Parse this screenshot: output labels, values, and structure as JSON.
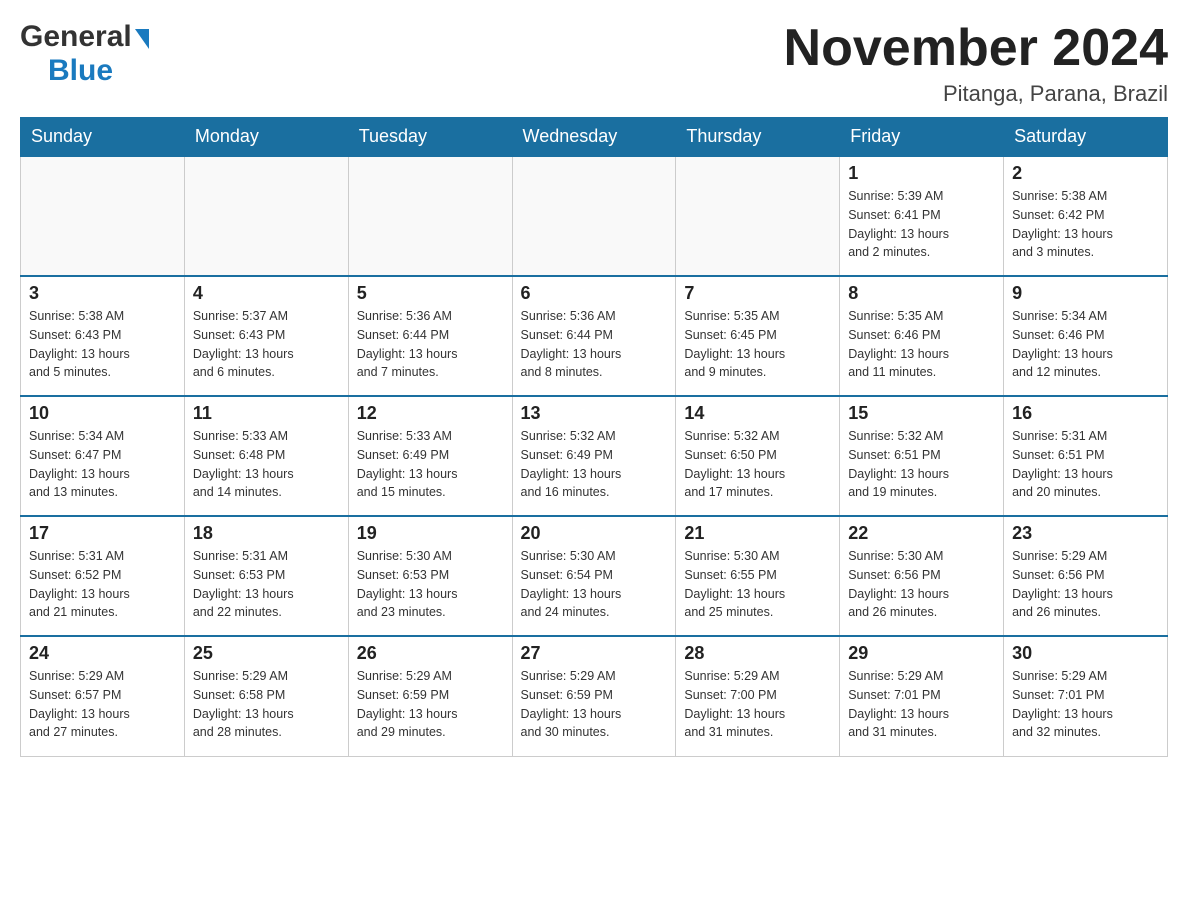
{
  "header": {
    "logo_general": "General",
    "logo_triangle": "▶",
    "logo_blue": "Blue",
    "month_title": "November 2024",
    "location": "Pitanga, Parana, Brazil"
  },
  "weekdays": [
    "Sunday",
    "Monday",
    "Tuesday",
    "Wednesday",
    "Thursday",
    "Friday",
    "Saturday"
  ],
  "weeks": [
    [
      {
        "day": "",
        "info": ""
      },
      {
        "day": "",
        "info": ""
      },
      {
        "day": "",
        "info": ""
      },
      {
        "day": "",
        "info": ""
      },
      {
        "day": "",
        "info": ""
      },
      {
        "day": "1",
        "info": "Sunrise: 5:39 AM\nSunset: 6:41 PM\nDaylight: 13 hours\nand 2 minutes."
      },
      {
        "day": "2",
        "info": "Sunrise: 5:38 AM\nSunset: 6:42 PM\nDaylight: 13 hours\nand 3 minutes."
      }
    ],
    [
      {
        "day": "3",
        "info": "Sunrise: 5:38 AM\nSunset: 6:43 PM\nDaylight: 13 hours\nand 5 minutes."
      },
      {
        "day": "4",
        "info": "Sunrise: 5:37 AM\nSunset: 6:43 PM\nDaylight: 13 hours\nand 6 minutes."
      },
      {
        "day": "5",
        "info": "Sunrise: 5:36 AM\nSunset: 6:44 PM\nDaylight: 13 hours\nand 7 minutes."
      },
      {
        "day": "6",
        "info": "Sunrise: 5:36 AM\nSunset: 6:44 PM\nDaylight: 13 hours\nand 8 minutes."
      },
      {
        "day": "7",
        "info": "Sunrise: 5:35 AM\nSunset: 6:45 PM\nDaylight: 13 hours\nand 9 minutes."
      },
      {
        "day": "8",
        "info": "Sunrise: 5:35 AM\nSunset: 6:46 PM\nDaylight: 13 hours\nand 11 minutes."
      },
      {
        "day": "9",
        "info": "Sunrise: 5:34 AM\nSunset: 6:46 PM\nDaylight: 13 hours\nand 12 minutes."
      }
    ],
    [
      {
        "day": "10",
        "info": "Sunrise: 5:34 AM\nSunset: 6:47 PM\nDaylight: 13 hours\nand 13 minutes."
      },
      {
        "day": "11",
        "info": "Sunrise: 5:33 AM\nSunset: 6:48 PM\nDaylight: 13 hours\nand 14 minutes."
      },
      {
        "day": "12",
        "info": "Sunrise: 5:33 AM\nSunset: 6:49 PM\nDaylight: 13 hours\nand 15 minutes."
      },
      {
        "day": "13",
        "info": "Sunrise: 5:32 AM\nSunset: 6:49 PM\nDaylight: 13 hours\nand 16 minutes."
      },
      {
        "day": "14",
        "info": "Sunrise: 5:32 AM\nSunset: 6:50 PM\nDaylight: 13 hours\nand 17 minutes."
      },
      {
        "day": "15",
        "info": "Sunrise: 5:32 AM\nSunset: 6:51 PM\nDaylight: 13 hours\nand 19 minutes."
      },
      {
        "day": "16",
        "info": "Sunrise: 5:31 AM\nSunset: 6:51 PM\nDaylight: 13 hours\nand 20 minutes."
      }
    ],
    [
      {
        "day": "17",
        "info": "Sunrise: 5:31 AM\nSunset: 6:52 PM\nDaylight: 13 hours\nand 21 minutes."
      },
      {
        "day": "18",
        "info": "Sunrise: 5:31 AM\nSunset: 6:53 PM\nDaylight: 13 hours\nand 22 minutes."
      },
      {
        "day": "19",
        "info": "Sunrise: 5:30 AM\nSunset: 6:53 PM\nDaylight: 13 hours\nand 23 minutes."
      },
      {
        "day": "20",
        "info": "Sunrise: 5:30 AM\nSunset: 6:54 PM\nDaylight: 13 hours\nand 24 minutes."
      },
      {
        "day": "21",
        "info": "Sunrise: 5:30 AM\nSunset: 6:55 PM\nDaylight: 13 hours\nand 25 minutes."
      },
      {
        "day": "22",
        "info": "Sunrise: 5:30 AM\nSunset: 6:56 PM\nDaylight: 13 hours\nand 26 minutes."
      },
      {
        "day": "23",
        "info": "Sunrise: 5:29 AM\nSunset: 6:56 PM\nDaylight: 13 hours\nand 26 minutes."
      }
    ],
    [
      {
        "day": "24",
        "info": "Sunrise: 5:29 AM\nSunset: 6:57 PM\nDaylight: 13 hours\nand 27 minutes."
      },
      {
        "day": "25",
        "info": "Sunrise: 5:29 AM\nSunset: 6:58 PM\nDaylight: 13 hours\nand 28 minutes."
      },
      {
        "day": "26",
        "info": "Sunrise: 5:29 AM\nSunset: 6:59 PM\nDaylight: 13 hours\nand 29 minutes."
      },
      {
        "day": "27",
        "info": "Sunrise: 5:29 AM\nSunset: 6:59 PM\nDaylight: 13 hours\nand 30 minutes."
      },
      {
        "day": "28",
        "info": "Sunrise: 5:29 AM\nSunset: 7:00 PM\nDaylight: 13 hours\nand 31 minutes."
      },
      {
        "day": "29",
        "info": "Sunrise: 5:29 AM\nSunset: 7:01 PM\nDaylight: 13 hours\nand 31 minutes."
      },
      {
        "day": "30",
        "info": "Sunrise: 5:29 AM\nSunset: 7:01 PM\nDaylight: 13 hours\nand 32 minutes."
      }
    ]
  ]
}
